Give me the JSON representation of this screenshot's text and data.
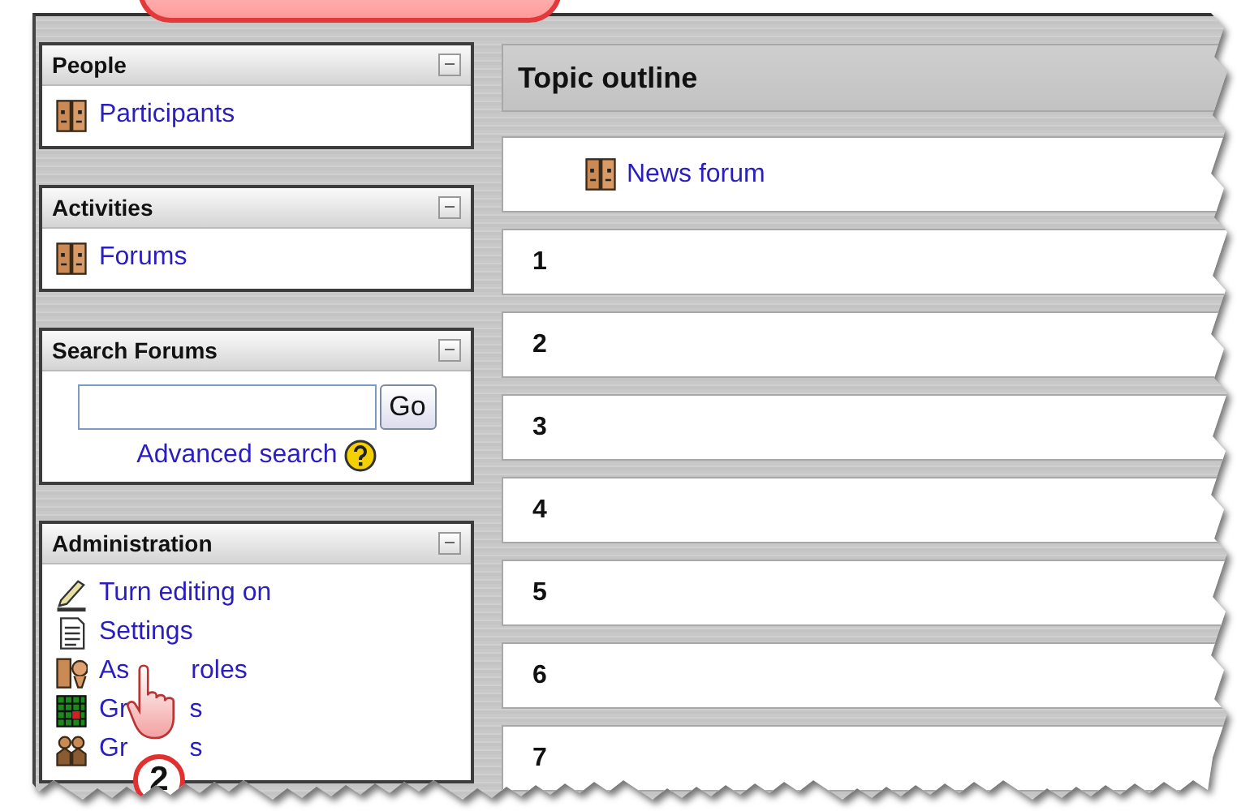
{
  "blocks": [
    {
      "title": "People",
      "kind": "links",
      "items": [
        {
          "label": "Participants",
          "kind": "people"
        }
      ]
    },
    {
      "title": "Activities",
      "kind": "links",
      "items": [
        {
          "label": "Forums",
          "kind": "forum"
        }
      ]
    },
    {
      "title": "Search Forums",
      "kind": "search",
      "button": "Go",
      "link": "Advanced search"
    },
    {
      "title": "Administration",
      "kind": "links",
      "items": [
        {
          "label": "Turn editing on",
          "kind": "edit"
        },
        {
          "label": "Settings",
          "kind": "settings"
        },
        {
          "parts": [
            "As",
            "roles"
          ],
          "kind": "roles"
        },
        {
          "parts": [
            "Gr",
            "s"
          ],
          "kind": "grades"
        },
        {
          "parts": [
            "Gr",
            "s"
          ],
          "kind": "groups"
        }
      ]
    }
  ],
  "main": {
    "title": "Topic outline",
    "news": "News forum",
    "sections": [
      "1",
      "2",
      "3",
      "4",
      "5",
      "6",
      "7"
    ]
  },
  "cursor": {
    "step": "2"
  }
}
